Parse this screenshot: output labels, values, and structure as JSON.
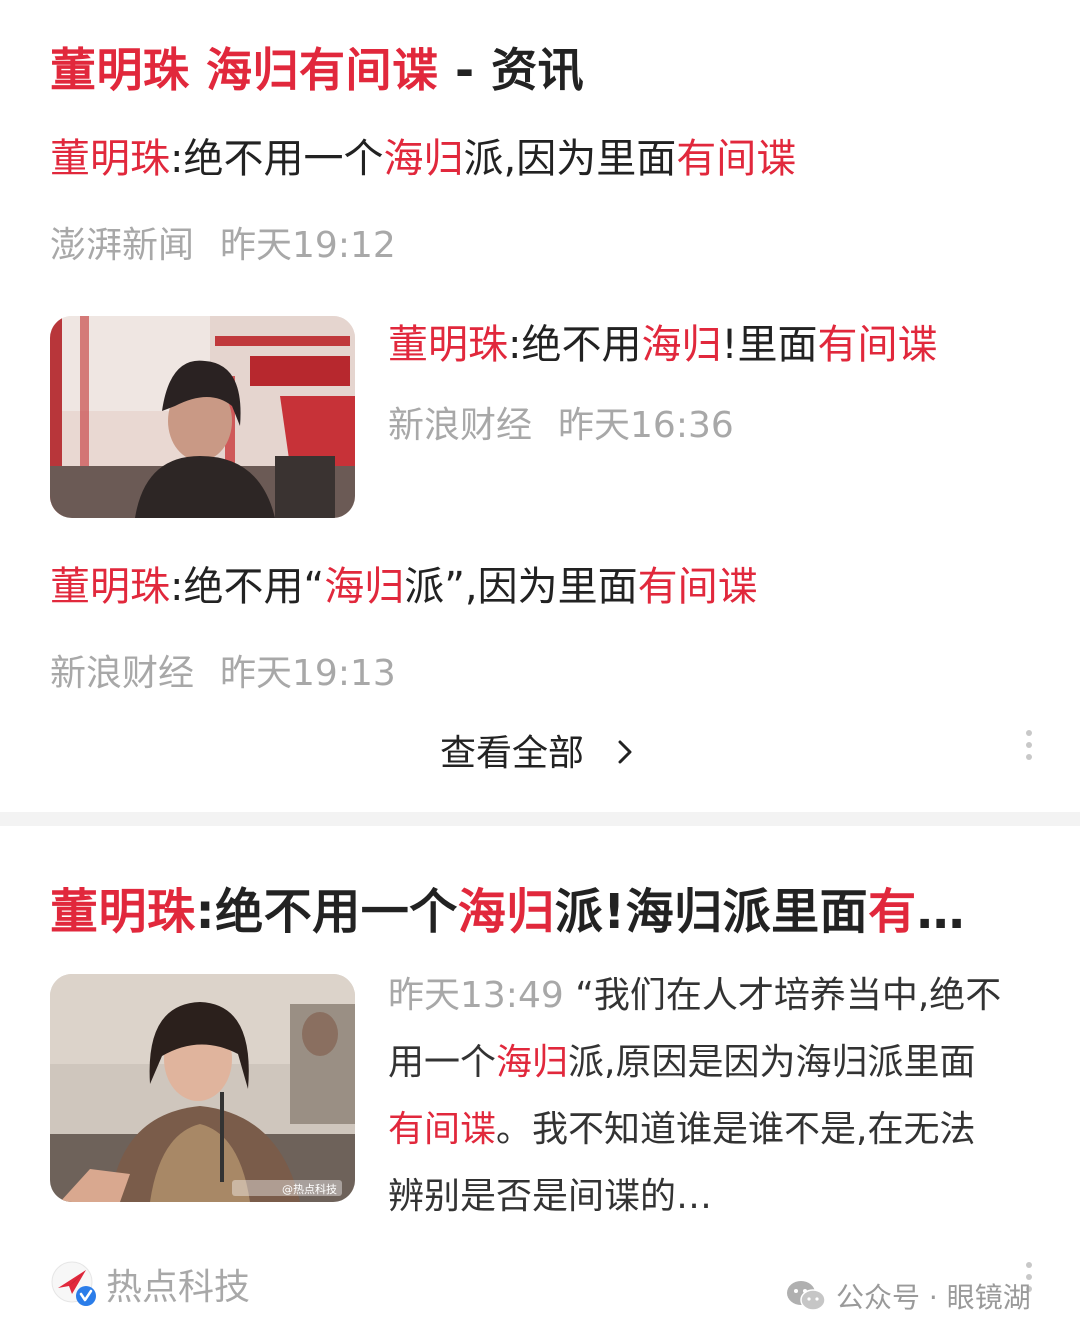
{
  "card1": {
    "header": {
      "hl": "董明珠 海归有间谍",
      "rest": " - 资讯"
    },
    "item1": {
      "title": [
        {
          "t": "董明珠",
          "hl": true
        },
        {
          "t": ":绝不用一个",
          "hl": false
        },
        {
          "t": "海归",
          "hl": true
        },
        {
          "t": "派,因为里面",
          "hl": false
        },
        {
          "t": "有间谍",
          "hl": true
        }
      ],
      "source": "澎湃新闻",
      "time": "昨天19:12"
    },
    "item2": {
      "title": [
        {
          "t": "董明珠",
          "hl": true
        },
        {
          "t": ":绝不用",
          "hl": false
        },
        {
          "t": "海归",
          "hl": true
        },
        {
          "t": "!里面",
          "hl": false
        },
        {
          "t": "有间谍",
          "hl": true
        }
      ],
      "source": "新浪财经",
      "time": "昨天16:36"
    },
    "item3": {
      "title": [
        {
          "t": "董明珠",
          "hl": true
        },
        {
          "t": ":绝不用“",
          "hl": false
        },
        {
          "t": "海归",
          "hl": true
        },
        {
          "t": "派”,因为里面",
          "hl": false
        },
        {
          "t": "有间谍",
          "hl": true
        }
      ],
      "source": "新浪财经",
      "time": "昨天19:13"
    },
    "view_all": "查看全部",
    "view_all_icon": "chevron-right-icon"
  },
  "card2": {
    "title": [
      {
        "t": "董明珠",
        "hl": true
      },
      {
        "t": ":绝不用一个",
        "hl": false
      },
      {
        "t": "海归",
        "hl": true
      },
      {
        "t": "派!海归派里面",
        "hl": false
      },
      {
        "t": "有",
        "hl": true
      },
      {
        "t": "…",
        "hl": false
      }
    ],
    "body": [
      {
        "t": "昨天13:49",
        "cls": "meta-inline"
      },
      {
        "t": " “我们在人才培养当中,绝不用一个",
        "hl": false
      },
      {
        "t": "海归",
        "hl": true
      },
      {
        "t": "派,原因是因为海归派里面",
        "hl": false
      },
      {
        "t": "有间谍",
        "hl": true
      },
      {
        "t": "。我不知道谁是谁不是,在无法辨别是否是间谍的…",
        "hl": false
      }
    ],
    "image_watermark": "@热点科技",
    "source": "热点科技",
    "source_icon": "verified-badge-icon"
  },
  "watermark": {
    "icon": "wechat-icon",
    "text": "公众号 · 眼镜湖"
  },
  "colors": {
    "highlight": "#e1283c",
    "meta": "#a8a8a8",
    "text": "#222222"
  }
}
